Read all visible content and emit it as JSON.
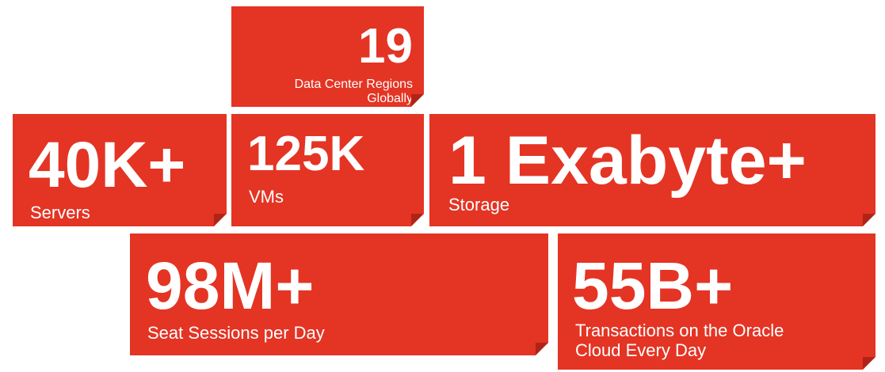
{
  "colors": {
    "tile_red": "#e43424",
    "corner_shadow": "#b02418",
    "text": "#ffffff",
    "background": "#ffffff"
  },
  "tiles": {
    "regions": {
      "value": "19",
      "label_line1": "Data Center Regions",
      "label_line2": "Globally"
    },
    "servers": {
      "value": "40K+",
      "label": "Servers"
    },
    "vms": {
      "value": "125K",
      "label": "VMs"
    },
    "storage": {
      "value": "1 Exabyte+",
      "label": "Storage"
    },
    "sessions": {
      "value": "98M+",
      "label": "Seat Sessions per Day"
    },
    "transactions": {
      "value": "55B+",
      "label_line1": "Transactions on the Oracle",
      "label_line2": "Cloud Every Day"
    }
  }
}
